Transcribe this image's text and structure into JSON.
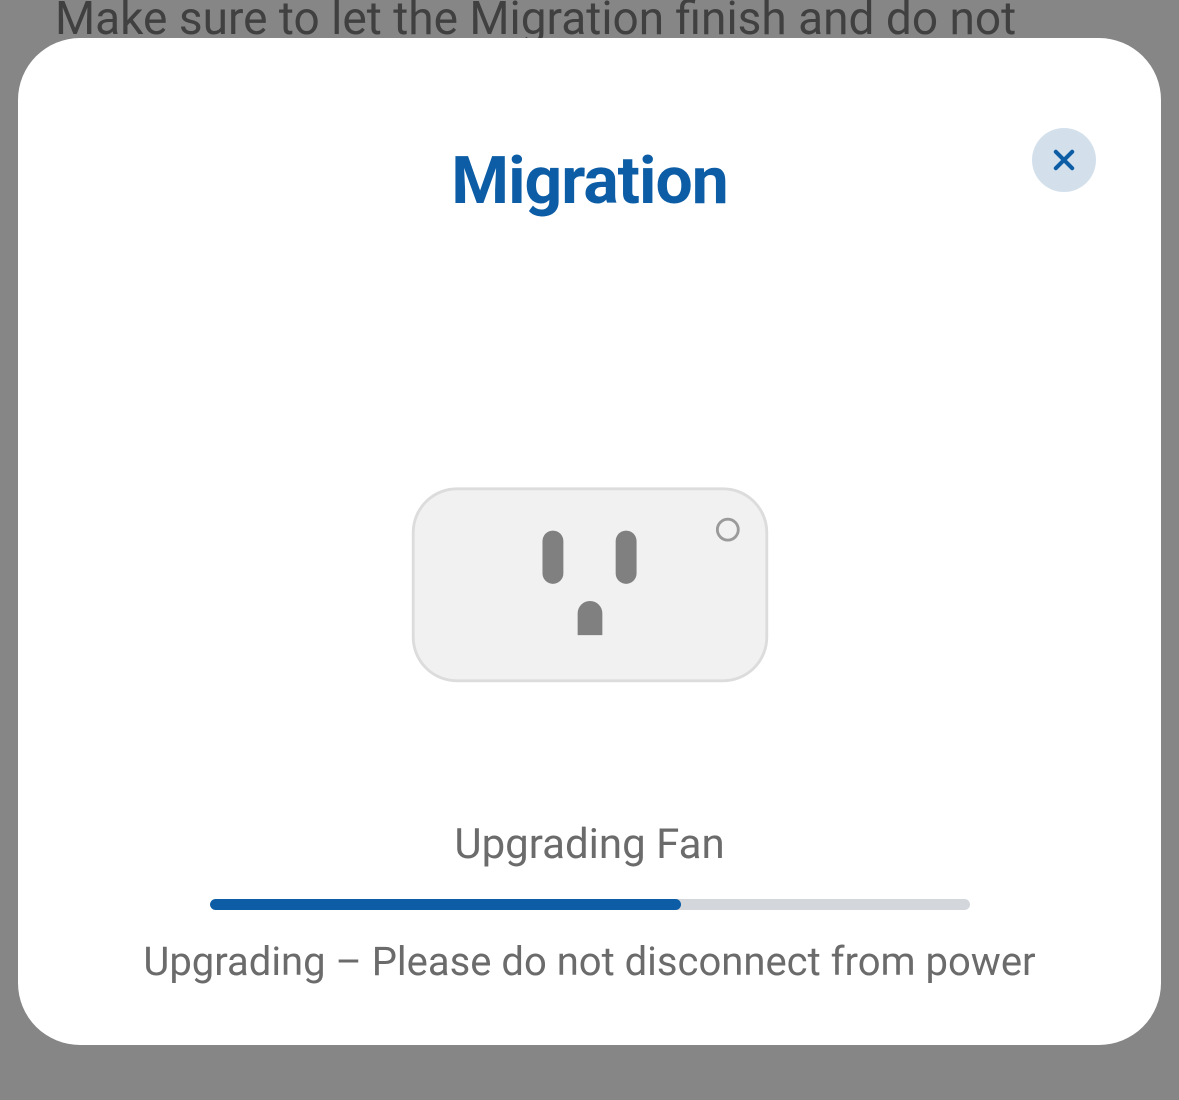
{
  "background": {
    "text": "Make sure to let the Migration finish and do not"
  },
  "modal": {
    "title": "Migration",
    "status": "Upgrading Fan",
    "progress_percent": 62,
    "warning": "Upgrading – Please do not disconnect from power"
  },
  "icons": {
    "close": "close-icon",
    "plug": "smart-plug-icon"
  },
  "colors": {
    "accent": "#0c5da5",
    "close_bg": "#d3e0ec",
    "progress_track": "#d3d6db",
    "text_muted": "#6b6b6b"
  }
}
